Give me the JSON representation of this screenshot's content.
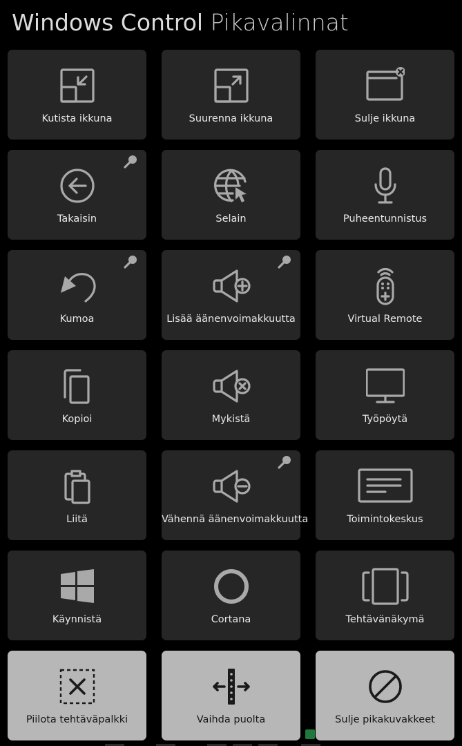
{
  "header": {
    "title_strong": "Windows Control",
    "title_light": "Pikavalinnat"
  },
  "tiles": [
    {
      "label": "Kutista ikkuna",
      "icon": "minimize-window-icon"
    },
    {
      "label": "Suurenna ikkuna",
      "icon": "maximize-window-icon"
    },
    {
      "label": "Sulje ikkuna",
      "icon": "close-window-icon"
    },
    {
      "label": "Takaisin",
      "icon": "back-arrow-icon",
      "pinned": true
    },
    {
      "label": "Selain",
      "icon": "browser-globe-icon"
    },
    {
      "label": "Puheentunnistus",
      "icon": "microphone-icon"
    },
    {
      "label": "Kumoa",
      "icon": "undo-icon",
      "pinned": true
    },
    {
      "label": "Lisää äänenvoimakkuutta",
      "icon": "volume-up-icon",
      "pinned": true
    },
    {
      "label": "Virtual Remote",
      "icon": "remote-control-icon"
    },
    {
      "label": "Kopioi",
      "icon": "copy-icon"
    },
    {
      "label": "Mykistä",
      "icon": "mute-icon"
    },
    {
      "label": "Työpöytä",
      "icon": "desktop-monitor-icon"
    },
    {
      "label": "Liitä",
      "icon": "paste-icon"
    },
    {
      "label": "Vähennä äänenvoimakkuutta",
      "icon": "volume-down-icon",
      "pinned": true
    },
    {
      "label": "Toimintokeskus",
      "icon": "action-center-icon"
    },
    {
      "label": "Käynnistä",
      "icon": "windows-start-icon"
    },
    {
      "label": "Cortana",
      "icon": "cortana-ring-icon"
    },
    {
      "label": "Tehtävänäkymä",
      "icon": "task-view-icon"
    }
  ],
  "actions": [
    {
      "label": "Piilota tehtäväpalkki",
      "icon": "hide-taskbar-icon"
    },
    {
      "label": "Vaihda puolta",
      "icon": "switch-side-icon"
    },
    {
      "label": "Sulje pikakuvakkeet",
      "icon": "close-shortcuts-icon"
    }
  ],
  "colors": {
    "background": "#000000",
    "tile": "#262626",
    "action_tile": "#b7b7b7",
    "icon_gray": "#a9a9a9"
  }
}
